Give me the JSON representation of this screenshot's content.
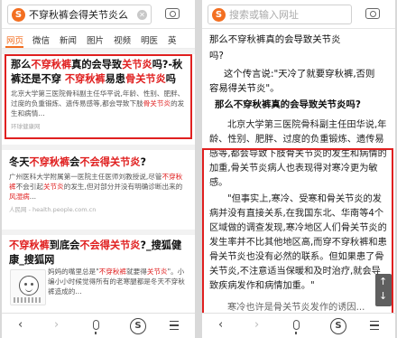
{
  "left": {
    "query": "不穿秋裤会得关节炎么",
    "tabs": [
      "网页",
      "微信",
      "新闻",
      "图片",
      "视频",
      "明医",
      "英"
    ],
    "results": [
      {
        "title_parts": [
          "那么",
          "不穿秋裤",
          "真的会导致",
          "关节炎",
          "吗?-秋裤还是不穿 ",
          "不穿秋裤",
          "易患",
          "骨关节炎",
          "吗"
        ],
        "snippet_parts": [
          "北京大学第三医院骨科副主任华平说,年龄、性别、肥胖、过度的负重锻炼、遗传易感等,都会导致下肢",
          "骨关节炎",
          "的发生和病情..."
        ],
        "source": "环球健康网"
      },
      {
        "title_parts": [
          "冬天",
          "不穿秋裤",
          "会",
          "不会得关节炎",
          "?"
        ],
        "snippet_parts": [
          "广州医科大学附属第一医院主任医师刘教授说,尽管",
          "不穿秋裤",
          "不会引起",
          "关节炎",
          "的发生,但对部分并没有明确诊断出来的",
          "风湿病",
          "..."
        ],
        "source": "人民网 - health.people.com.cn"
      },
      {
        "title_parts": [
          "不穿秋裤",
          "到底会",
          "不会得关节炎",
          "?_搜狐健康_搜狐网"
        ],
        "snippet_parts": [
          "妈妈的嘴里总是\"",
          "不穿秋裤",
          "就要得",
          "关节炎",
          "\"。小编小小时候觉得所有的老寒腿都是冬天不穿秋裤造成的..."
        ]
      }
    ]
  },
  "right": {
    "placeholder": "搜索或输入网址",
    "heading_lines": [
      "那么不穿秋裤真的会导致关节炎",
      "吗?"
    ],
    "intro_lines": [
      "这个传言说:\"天冷了就要穿秋裤,否则",
      "容易得关节炎\"。"
    ],
    "question": "那么不穿秋裤真的会导致关节炎吗?",
    "paragraph1": "北京大学第三医院骨科副主任田华说,年龄、性别、肥胖、过度的负重锻炼、遗传易感等,都会导致下肢骨关节炎的发生和病情的加重,骨关节炎病人也表现得对寒冷更为敏感。",
    "paragraph2": "\"但事实上,寒冷、受寒和骨关节炎的发病并没有直接关系,在我国东北、华南等4个区域做的调查发现,寒冷地区人们骨关节炎的发生率并不比其他地区高,而穿不穿秋裤和患骨关节炎也没有必然的联系。但如果患了骨关节炎,不注意适当保暖和及时治疗,就会导致疾病发作和病情加重。\"",
    "tail": "寒冷也许是骨关节炎发作的诱因..."
  }
}
